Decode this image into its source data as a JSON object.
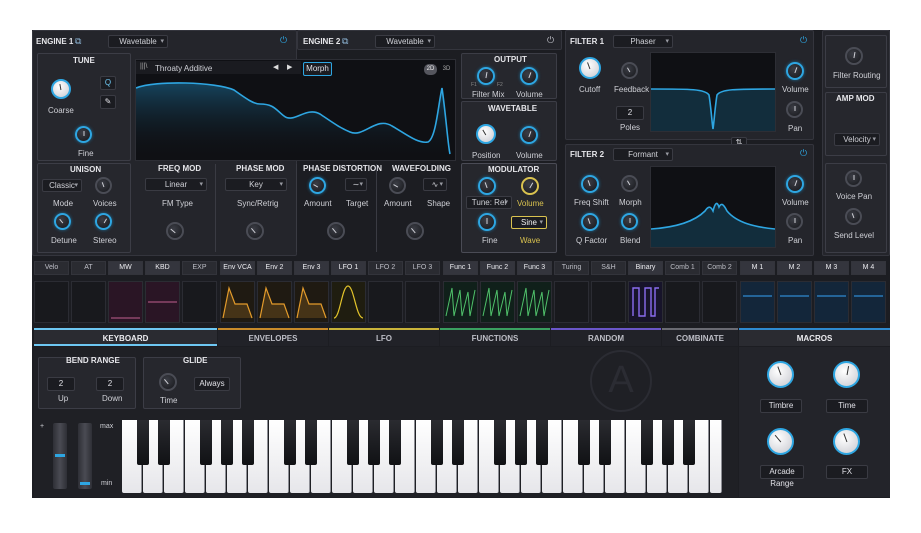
{
  "engine1": {
    "title": "ENGINE 1",
    "mode": "Wavetable"
  },
  "engine2": {
    "title": "ENGINE 2",
    "mode": "Wavetable"
  },
  "tune": {
    "title": "TUNE",
    "coarse": "Coarse",
    "fine": "Fine",
    "q_btn": "Q"
  },
  "wave_display": {
    "name": "Throaty Additive",
    "morph": "Morph",
    "view2d": "2D",
    "view3d": "3D"
  },
  "output": {
    "title": "OUTPUT",
    "filter_mix": "Filter Mix",
    "volume": "Volume",
    "f1": "F1",
    "f2": "F2"
  },
  "wavetable": {
    "title": "WAVETABLE",
    "position": "Position",
    "volume": "Volume"
  },
  "unison": {
    "title": "UNISON",
    "mode_value": "Classic",
    "mode": "Mode",
    "voices": "Voices",
    "detune": "Detune",
    "stereo": "Stereo"
  },
  "freq_mod": {
    "title": "FREQ MOD",
    "value": "Linear",
    "label": "FM Type"
  },
  "phase_mod": {
    "title": "PHASE MOD",
    "value": "Key",
    "label": "Sync/Retrig"
  },
  "phase_dist": {
    "title": "PHASE DISTORTION",
    "amount": "Amount",
    "target": "Target"
  },
  "wavefolding": {
    "title": "WAVEFOLDING",
    "amount": "Amount",
    "shape": "Shape"
  },
  "modulator": {
    "title": "MODULATOR",
    "tune": "Tune: Rel",
    "volume": "Volume",
    "fine": "Fine",
    "wave_value": "Sine",
    "wave": "Wave"
  },
  "filter1": {
    "title": "FILTER 1",
    "type": "Phaser",
    "cutoff": "Cutoff",
    "feedback": "Feedback",
    "poles_value": "2",
    "poles": "Poles",
    "volume": "Volume",
    "pan": "Pan"
  },
  "filter2": {
    "title": "FILTER 2",
    "type": "Formant",
    "freq_shift": "Freq Shift",
    "morph": "Morph",
    "q_factor": "Q Factor",
    "blend": "Blend",
    "volume": "Volume",
    "pan": "Pan"
  },
  "routing": {
    "label": "Filter Routing"
  },
  "amp_mod": {
    "title": "AMP MOD",
    "value": "Velocity"
  },
  "voice": {
    "voice_pan": "Voice Pan",
    "send_level": "Send Level"
  },
  "mod_tabs": [
    "Velo",
    "AT",
    "MW",
    "KBD",
    "EXP",
    "Env VCA",
    "Env 2",
    "Env 3",
    "LFO 1",
    "LFO 2",
    "LFO 3",
    "Func 1",
    "Func 2",
    "Func 3",
    "Turing",
    "S&H",
    "Binary",
    "Comb 1",
    "Comb 2",
    "M 1",
    "M 2",
    "M 3",
    "M 4"
  ],
  "bottom_tabs": [
    "KEYBOARD",
    "ENVELOPES",
    "LFO",
    "FUNCTIONS",
    "RANDOM",
    "COMBINATE",
    "MACROS"
  ],
  "bend": {
    "title": "BEND RANGE",
    "up_value": "2",
    "up": "Up",
    "down_value": "2",
    "down": "Down"
  },
  "glide": {
    "title": "GLIDE",
    "time": "Time",
    "mode": "Always"
  },
  "wheels": {
    "plus": "+",
    "max": "max",
    "min": "min"
  },
  "macros": {
    "m1": "Timbre",
    "m2": "Time",
    "m3": "Arcade Range",
    "m4": "FX"
  },
  "colors": {
    "accent": "#2ea6e2",
    "bg": "#24252b",
    "envelope": "#e39b2b",
    "function": "#4fc06a",
    "binary": "#8a6cf0",
    "macro": "#2e8ad0"
  }
}
